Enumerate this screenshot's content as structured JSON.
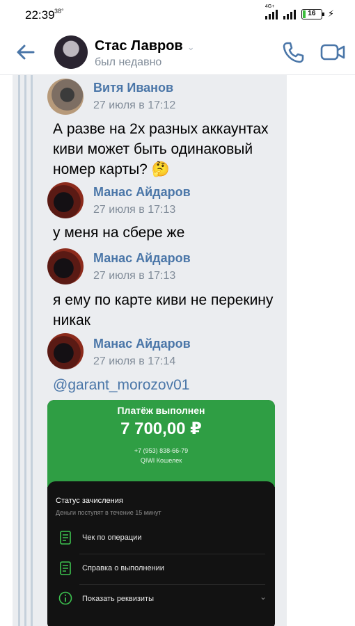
{
  "status_bar": {
    "time": "22:39",
    "temp": "38°",
    "network_label": "4G+",
    "battery": "16"
  },
  "header": {
    "name": "Стас Лавров",
    "status": "был недавно"
  },
  "messages": [
    {
      "author": "Витя Иванов",
      "time": "27 июля в 17:12",
      "text": "А разве на 2х разных аккаунтах киви может быть одинаковый номер карты? 🤔"
    },
    {
      "author": "Манас Айдаров",
      "time": "27 июля в 17:13",
      "text": "у меня на сбере же"
    },
    {
      "author": "Манас Айдаров",
      "time": "27 июля в 17:13",
      "text": "я ему по карте киви не перекину никак"
    },
    {
      "author": "Манас Айдаров",
      "time": "27 июля в 17:14",
      "text": "@garant_morozov01"
    }
  ],
  "receipt": {
    "title": "Платёж выполнен",
    "amount": "7 700,00 ₽",
    "phone": "+7 (953) 838-66-79",
    "wallet": "QIWI Кошелек",
    "status_title": "Статус зачисления",
    "status_sub": "Деньги поступят в течение 15 минут",
    "rows": [
      {
        "label": "Чек по операции"
      },
      {
        "label": "Справка о выполнении"
      },
      {
        "label": "Показать реквизиты"
      }
    ]
  },
  "colors": {
    "accent": "#4a76a8",
    "qiwi_green": "#2f9e44"
  }
}
